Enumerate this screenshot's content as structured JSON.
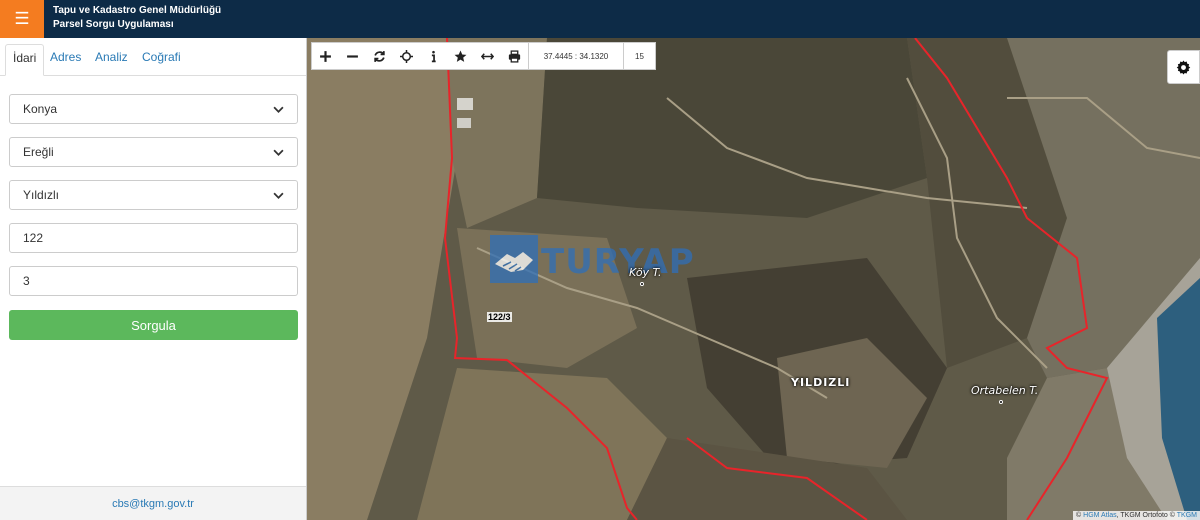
{
  "header": {
    "menu_icon": "hamburger-icon",
    "title_line1": "Tapu ve Kadastro Genel Müdürlüğü",
    "title_line2": "Parsel Sorgu Uygulaması"
  },
  "sidebar": {
    "tabs": [
      {
        "label": "İdari",
        "active": true
      },
      {
        "label": "Adres",
        "active": false
      },
      {
        "label": "Analiz",
        "active": false
      },
      {
        "label": "Coğrafi",
        "active": false
      }
    ],
    "fields": {
      "province": "Konya",
      "district": "Ereğli",
      "neighborhood": "Yıldızlı",
      "block_no": "122",
      "parcel_no": "3"
    },
    "submit_label": "Sorgula",
    "footer_email": "cbs@tkgm.gov.tr"
  },
  "map": {
    "toolbar": {
      "tools": [
        "zoom-in-icon",
        "zoom-out-icon",
        "refresh-icon",
        "locate-icon",
        "info-icon",
        "star-icon",
        "measure-icon",
        "print-icon"
      ],
      "coordinates": "37.4445 : 34.1320",
      "zoom_level": "15"
    },
    "labels": {
      "koy": "Köy T.",
      "yildizli": "YILDIZLI",
      "ortabelen": "Ortabelen T.",
      "parcel": "122/3",
      "watermark": "TURYAP"
    },
    "attribution": {
      "prefix": "©",
      "hgm": "HGM Atlas",
      "middle": ", TKGM Ortofoto ©",
      "tkgm": "TKGM"
    },
    "colors": {
      "boundary": "#e8242a",
      "water": "#2d5f7e"
    }
  },
  "colors": {
    "header_bg": "#0d2b47",
    "menu_btn": "#f47c20",
    "submit_btn": "#5cb85c",
    "link": "#2a7ab5"
  }
}
